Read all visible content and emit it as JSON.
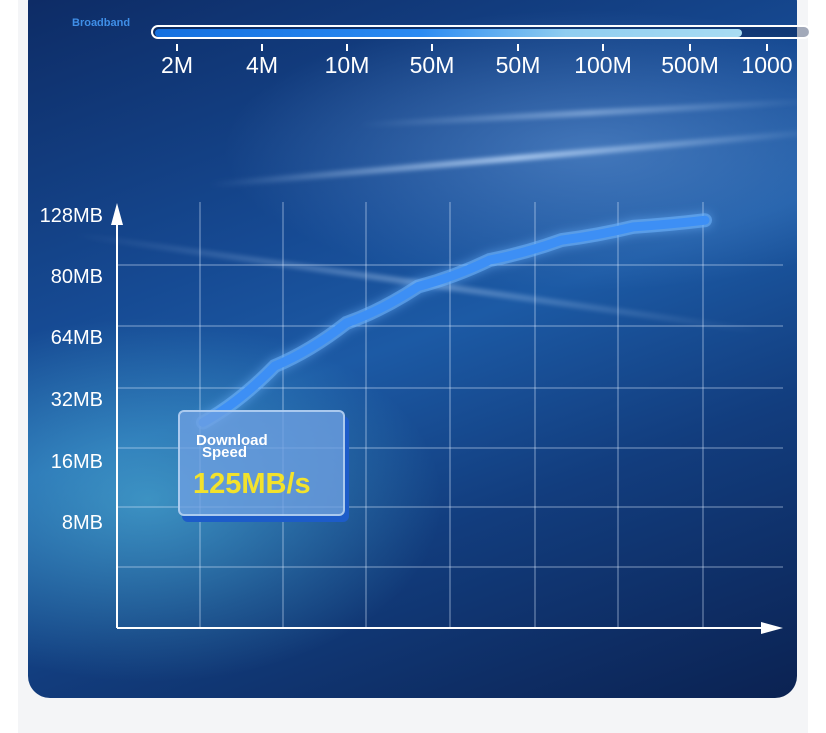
{
  "header": {
    "broadband_label": "Broadband",
    "bar_fill_fraction": 0.9
  },
  "download_box": {
    "title": "Download\nSpeed",
    "value": "125MB/s"
  },
  "chart_data": {
    "type": "line",
    "x_tick_labels": [
      "2M",
      "4M",
      "10M",
      "50M",
      "50M",
      "100M",
      "500M",
      "1000"
    ],
    "y_tick_labels": [
      "128MB",
      "80MB",
      "64MB",
      "32MB",
      "16MB",
      "8MB"
    ],
    "x": [
      "2M",
      "4M",
      "10M",
      "50M",
      "50M",
      "100M",
      "500M",
      "1000"
    ],
    "series": [
      {
        "values": [
          62,
          79,
          92,
          103,
          111,
          117,
          121,
          123
        ]
      }
    ],
    "grid": true,
    "line_color": "#3d8ff5"
  },
  "colors": {
    "accent": "#3d8ff5",
    "value_text": "#f2e22c",
    "card_background": "#164a93"
  }
}
